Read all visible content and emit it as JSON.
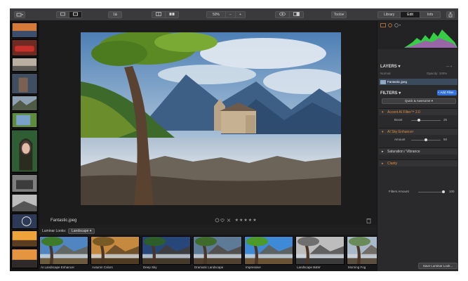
{
  "toolbar": {
    "zoom_value": "1&",
    "zoom_percent": "50%",
    "minus": "−",
    "plus": "+",
    "tools": "Tools",
    "tools_arrow": "▾",
    "tabs": [
      "Library",
      "Edit",
      "Info"
    ],
    "active_tab": "Edit"
  },
  "image": {
    "filename": "Fantastic.jpeg",
    "rating_stars": "★★★★★",
    "rating_value": 0
  },
  "right_panel": {
    "layers_title": "LAYERS",
    "layer_blend": "Normal",
    "layer_opacity": "Opacity: 100%",
    "layer_name": "Fantastic.jpeg",
    "filters_title": "FILTERS",
    "add_filter": "+ Add Filter...",
    "preset": "Quick & Awesome",
    "filters": [
      {
        "name": "Accent AI Filter™ 2.0",
        "color": "orange",
        "slider_label": "Boost",
        "slider_value": "25",
        "fraction": 0.25
      },
      {
        "name": "AI Sky Enhancer",
        "color": "orange",
        "slider_label": "Amount",
        "slider_value": "50",
        "fraction": 0.5
      },
      {
        "name": "Saturation / Vibrance",
        "color": "white"
      },
      {
        "name": "Clarity",
        "color": "orange"
      }
    ],
    "filters_amount_label": "Filters Amount",
    "filters_amount_value": "100",
    "filters_amount_fraction": 1.0,
    "save_look": "Save Luminar Look..."
  },
  "looks": {
    "label": "Luminar Looks:",
    "category": "Landscape",
    "items": [
      "AI Landscape Enhancer",
      "Autumn Colors",
      "Deep Sky",
      "Dramatic Landscape",
      "Impressive",
      "Landscape B&W",
      "Morning Fog"
    ]
  },
  "colors": {
    "accent_blue": "#2f6fd6",
    "filter_orange": "#e28a3a",
    "histogram_green": "#39e04a",
    "histogram_magenta": "#c23bd0"
  }
}
